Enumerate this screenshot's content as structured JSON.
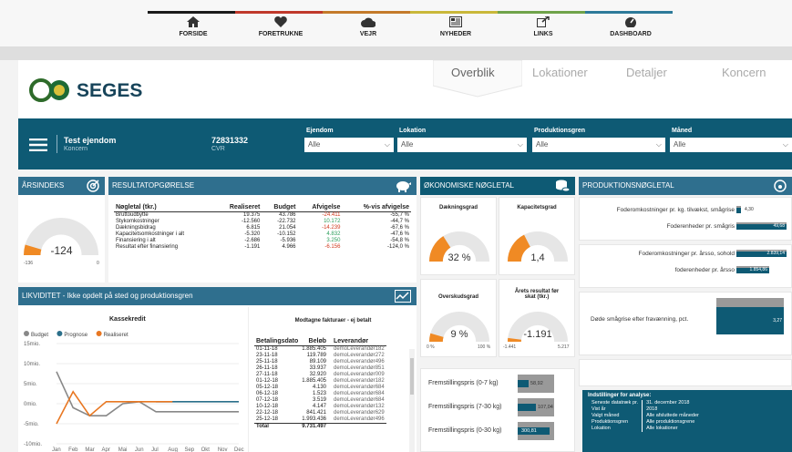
{
  "nav": {
    "items": [
      {
        "label": "FORSIDE",
        "icon": "home-icon"
      },
      {
        "label": "FORETRUKNE",
        "icon": "heart-icon"
      },
      {
        "label": "VEJR",
        "icon": "cloud-icon"
      },
      {
        "label": "NYHEDER",
        "icon": "newspaper-icon"
      },
      {
        "label": "LINKS",
        "icon": "external-link-icon"
      },
      {
        "label": "DASHBOARD",
        "icon": "dashboard-icon"
      }
    ],
    "bar_colors": [
      "#1a1a1a",
      "#c0392b",
      "#c47a2a",
      "#c9b83a",
      "#6fa34a",
      "#2d7a9a"
    ]
  },
  "logo": {
    "text": "SEGES"
  },
  "tabs": [
    "Overblik",
    "Lokationer",
    "Detaljer",
    "Koncern"
  ],
  "filters": {
    "company_name": "Test ejendom",
    "company_sub": "Koncern",
    "cvr": "72831332",
    "cvr_label": "CVR",
    "ejendom_label": "Ejendom",
    "ejendom_value": "Alle",
    "lokation_label": "Lokation",
    "lokation_value": "Alle",
    "produktionsgren_label": "Produktionsgren",
    "produktionsgren_value": "Alle",
    "maaned_label": "Måned",
    "maaned_value": "Alle"
  },
  "aarsindeks": {
    "title": "ÅRSINDEKS",
    "value": "-124",
    "min": "-136",
    "max": "0",
    "fraction": 0.09
  },
  "resultat": {
    "title": "RESULTATOPGØRELSE",
    "headers": [
      "Nøgletal (tkr.)",
      "Realiseret",
      "Budget",
      "Afvigelse",
      "%-vis afvigelse"
    ],
    "rows": [
      [
        "Bruttoudbytte",
        "19.375",
        "43.786",
        "-24.411",
        "-55,7 %"
      ],
      [
        "Stykomkostninger",
        "-12.560",
        "-22.732",
        "10.172",
        "-44,7 %"
      ],
      [
        "Dækningsbidrag",
        "6.815",
        "21.054",
        "-14.239",
        "-67,6 %"
      ],
      [
        "Kapacitetsomkostninger i alt",
        "-5.320",
        "-10.152",
        "4.832",
        "-47,6 %"
      ],
      [
        "Finansiering i alt",
        "-2.686",
        "-5.936",
        "3.250",
        "-54,8 %"
      ],
      [
        "Resultat efter finansiering",
        "-1.191",
        "4.966",
        "-6.156",
        "-124,0 %"
      ]
    ]
  },
  "okonomi": {
    "title": "ØKONOMISKE NØGLETAL",
    "daekningsgrad": {
      "title": "Dækningsgrad",
      "value": "32 %",
      "fraction": 0.32
    },
    "kapacitetsgrad": {
      "title": "Kapacitetsgrad",
      "value": "1,4",
      "fraction": 0.35
    },
    "overskudsgrad": {
      "title": "Overskudsgrad",
      "value": "9 %",
      "min": "0 %",
      "max": "100 %",
      "fraction": 0.09
    },
    "aarsresultat": {
      "title": "Årets resultat før skat (tkr.)",
      "value": "-1.191",
      "min": "-1.441",
      "max": "5.217",
      "fraction": 0.04
    }
  },
  "produktion": {
    "title": "PRODUKTIONSNØGLETAL",
    "group1": [
      {
        "label": "Foderomkostninger pr. kg. tilvækst, smågrise",
        "value": "4,30",
        "fraction": 0.08
      },
      {
        "label": "Foderenheder pr. smågris",
        "value": "49,68",
        "fraction": 0.92
      }
    ],
    "group2": [
      {
        "label": "Foderomkostninger pr. årsso, sohold",
        "value": "2.839,14",
        "fraction": 0.92
      },
      {
        "label": "foderenheder pr. årsso",
        "value": "1.854,86",
        "fraction": 0.6
      }
    ],
    "group3": [
      {
        "label": "Døde smågrise efter fravænning, pct.",
        "value": "3,27",
        "fraction": 1.0
      }
    ]
  },
  "fremstilling": [
    {
      "label": "Fremstillingspris (0-7 kg)",
      "value": "58,92",
      "fraction": 0.3
    },
    {
      "label": "Fremstillingspris (7-30 kg)",
      "value": "107,04",
      "fraction": 0.5
    },
    {
      "label": "Fremstillingspris (0-30 kg)",
      "value": "300,81",
      "fraction": 0.88
    }
  ],
  "likviditet": {
    "title": "LIKVIDITET - Ikke opdelt på sted og produktionsgren",
    "chart_title": "Kassekredit",
    "legend": [
      "Budget",
      "Prognose",
      "Realiseret"
    ]
  },
  "chart_data": {
    "type": "line",
    "title": "Kassekredit",
    "x": [
      "Jan",
      "Feb",
      "Mar",
      "Apr",
      "Mai",
      "Jun",
      "Jul",
      "Aug",
      "Sep",
      "Okt",
      "Nov",
      "Dec"
    ],
    "ylabels": [
      "15mio.",
      "10mio.",
      "5mio.",
      "0mio.",
      "-5mio.",
      "-10mio."
    ],
    "ylim": [
      -10,
      15
    ],
    "series": [
      {
        "name": "Budget",
        "color": "#888888",
        "values": [
          8,
          -1,
          -3,
          -3,
          0,
          0.5,
          -2,
          -2,
          -2,
          -2,
          -2,
          -2
        ]
      },
      {
        "name": "Prognose",
        "color": "#2b6f8a",
        "values": [
          null,
          null,
          null,
          null,
          null,
          null,
          0.5,
          0.5,
          0.5,
          0.5,
          0.5,
          0.5
        ]
      },
      {
        "name": "Realiseret",
        "color": "#e87722",
        "values": [
          -5,
          3,
          -3,
          0.5,
          0.5,
          0.5,
          0.5,
          0.5,
          null,
          null,
          null,
          null
        ]
      }
    ]
  },
  "fakturaer": {
    "title": "Modtagne fakturaer - ej betalt",
    "headers": [
      "Betalingsdato",
      "Beløb",
      "Leverandør"
    ],
    "rows": [
      [
        "01-11-18",
        "1.885.405",
        "demoLeverandør182"
      ],
      [
        "23-11-18",
        "119.789",
        "demoLeverandør272"
      ],
      [
        "25-11-18",
        "89.109",
        "demoLeverandør496"
      ],
      [
        "26-11-18",
        "33.937",
        "demoLeverandør851"
      ],
      [
        "27-11-18",
        "32.920",
        "demoLeverandør009"
      ],
      [
        "01-12-18",
        "1.885.405",
        "demoLeverandør182"
      ],
      [
        "05-12-18",
        "4.130",
        "demoLeverandør684"
      ],
      [
        "06-12-18",
        "1.523",
        "demoLeverandør684"
      ],
      [
        "07-12-18",
        "3.519",
        "demoLeverandør684"
      ],
      [
        "10-12-18",
        "4.147",
        "demoLeverandør132"
      ],
      [
        "22-12-18",
        "841.421",
        "demoLeverandør629"
      ],
      [
        "25-12-18",
        "1.993.436",
        "demoLeverandør496"
      ]
    ],
    "total_label": "Total",
    "total_value": "9.731.497"
  },
  "indstillinger": {
    "title": "Indstillinger for analyse:",
    "rows": [
      [
        "Seneste datatræk pr.",
        "31. december 2018"
      ],
      [
        "Vist år",
        "2018"
      ],
      [
        "Valgt måned",
        "Alle afsluttede måneder"
      ],
      [
        "Produktionsgren",
        "Alle produktionsgrene"
      ],
      [
        "Lokation",
        "Alle lokationer"
      ]
    ]
  }
}
